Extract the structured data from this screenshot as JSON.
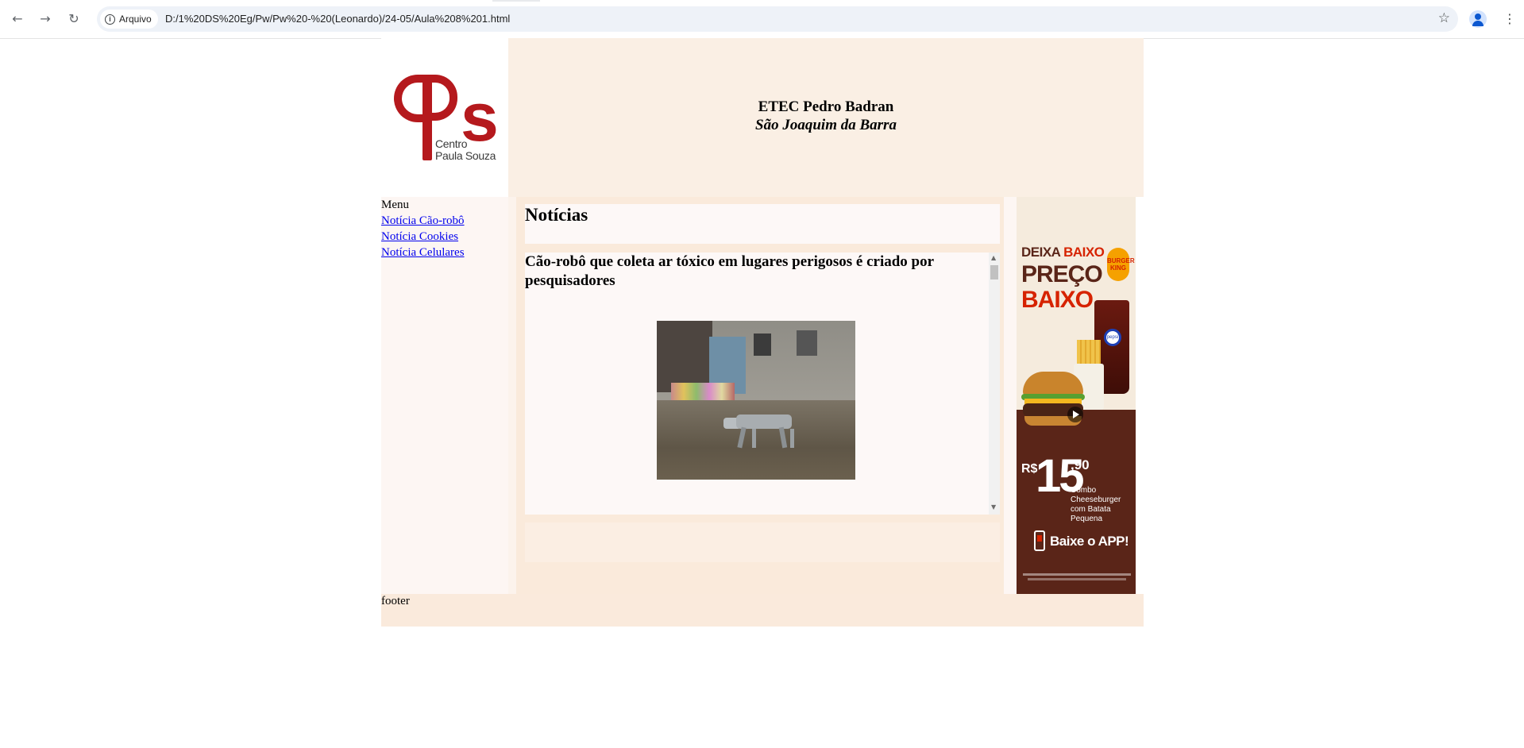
{
  "browser": {
    "security_chip": "Arquivo",
    "url": "D:/1%20DS%20Eg/Pw/Pw%20-%20(Leonardo)/24-05/Aula%208%201.html",
    "icons": [
      "back-arrow-icon",
      "forward-arrow-icon",
      "reload-icon",
      "info-icon",
      "bookmark-star-icon",
      "profile-icon",
      "more-menu-icon"
    ]
  },
  "logo": {
    "line1": "Centro",
    "line2": "Paula Souza",
    "color": "#b5191d"
  },
  "header": {
    "school": "ETEC Pedro Badran",
    "city": "São Joaquim da Barra"
  },
  "sidebar": {
    "title": "Menu",
    "links": [
      "Notícia Cão-robô",
      "Notícia Cookies",
      "Notícia Celulares"
    ]
  },
  "main": {
    "section_title": "Notícias",
    "article_title": "Cão-robô que coleta ar tóxico em lugares perigosos é criado por pesquisadores",
    "image_subject": "robot dog photo"
  },
  "ad": {
    "headline_part1": "DEIXA",
    "headline_part2": "BAIXO",
    "headline_line2": "PREÇO",
    "headline_line3": "BAIXO",
    "brand": "BURGER KING",
    "drink_brand": "pepsi",
    "currency": "R$",
    "price_whole": "15",
    "price_cents": ",90",
    "combo_line1": "Combo Cheeseburger",
    "combo_line2": "com Batata Pequena",
    "app_cta": "Baixe o APP!",
    "colors": {
      "brand_red": "#d62300",
      "brand_brown": "#5a2518"
    }
  },
  "footer": {
    "text": "footer"
  },
  "colors": {
    "header_bg": "#faefe4",
    "main_bg": "#faeadb",
    "panel_bg": "#fdf8f7",
    "link": "#0000ee"
  }
}
